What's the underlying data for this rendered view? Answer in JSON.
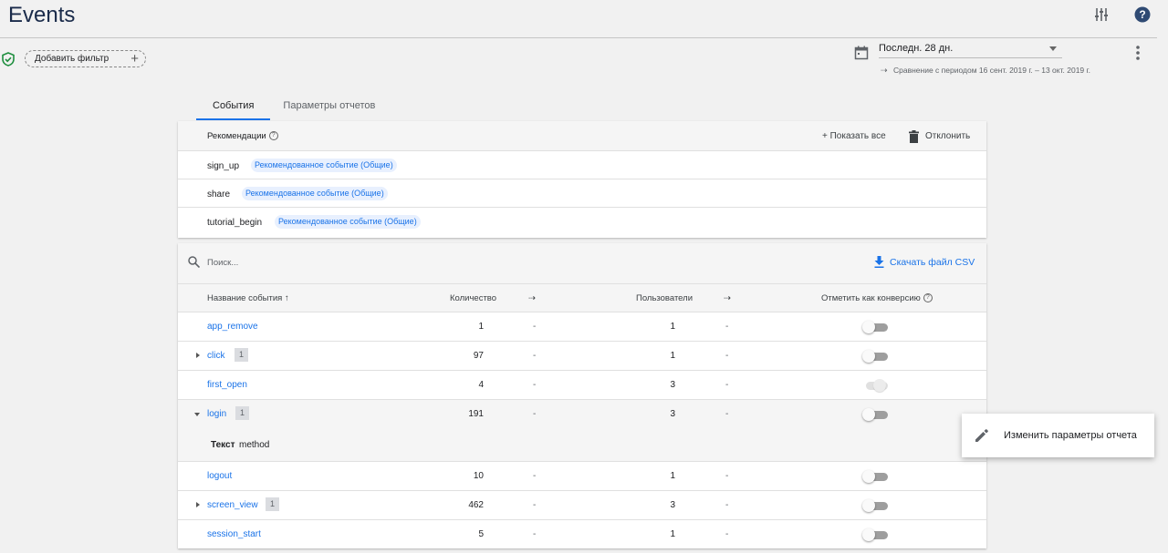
{
  "header": {
    "title": "Events",
    "icons": [
      "sliders-icon",
      "help-circle-icon"
    ]
  },
  "filter": {
    "add_filter_label": "Добавить фильтр",
    "plus": "+"
  },
  "date_range": {
    "selected": "Последн. 28 дн.",
    "comparison": "Сравнение с периодом 16 сент. 2019 г. – 13 окт. 2019 г."
  },
  "tabs": [
    {
      "label": "События",
      "active": true
    },
    {
      "label": "Параметры отчетов",
      "active": false
    }
  ],
  "recommendations": {
    "title": "Рекомендации",
    "show_all": "+ Показать все",
    "dismiss": "Отклонить",
    "items": [
      {
        "name": "sign_up",
        "badge": "Рекомендованное событие (Общие)"
      },
      {
        "name": "share",
        "badge": "Рекомендованное событие (Общие)"
      },
      {
        "name": "tutorial_begin",
        "badge": "Рекомендованное событие (Общие)"
      }
    ]
  },
  "events_table": {
    "search_placeholder": "Поиск...",
    "download_csv": "Скачать файл CSV",
    "columns": {
      "name": "Название события",
      "count": "Количество",
      "users": "Пользователи",
      "conversion": "Отметить как конверсию"
    },
    "rows": [
      {
        "name": "app_remove",
        "param_count": "",
        "count": "1",
        "count_change": "-",
        "users": "1",
        "users_change": "-",
        "conversion": false
      },
      {
        "name": "click",
        "param_count": "1",
        "count": "97",
        "count_change": "-",
        "users": "1",
        "users_change": "-",
        "conversion": false
      },
      {
        "name": "first_open",
        "param_count": "",
        "count": "4",
        "count_change": "-",
        "users": "3",
        "users_change": "-",
        "conversion": true
      },
      {
        "name": "login",
        "param_count": "1",
        "count": "191",
        "count_change": "-",
        "users": "3",
        "users_change": "-",
        "conversion": false
      },
      {
        "name": "logout",
        "param_count": "",
        "count": "10",
        "count_change": "-",
        "users": "1",
        "users_change": "-",
        "conversion": false
      },
      {
        "name": "screen_view",
        "param_count": "1",
        "count": "462",
        "count_change": "-",
        "users": "3",
        "users_change": "-",
        "conversion": false
      },
      {
        "name": "session_start",
        "param_count": "",
        "count": "5",
        "count_change": "-",
        "users": "1",
        "users_change": "-",
        "conversion": false
      }
    ],
    "expanded_param": {
      "type": "Текст",
      "name": "method"
    }
  },
  "context_menu": {
    "edit_params": "Изменить параметры отчета"
  }
}
